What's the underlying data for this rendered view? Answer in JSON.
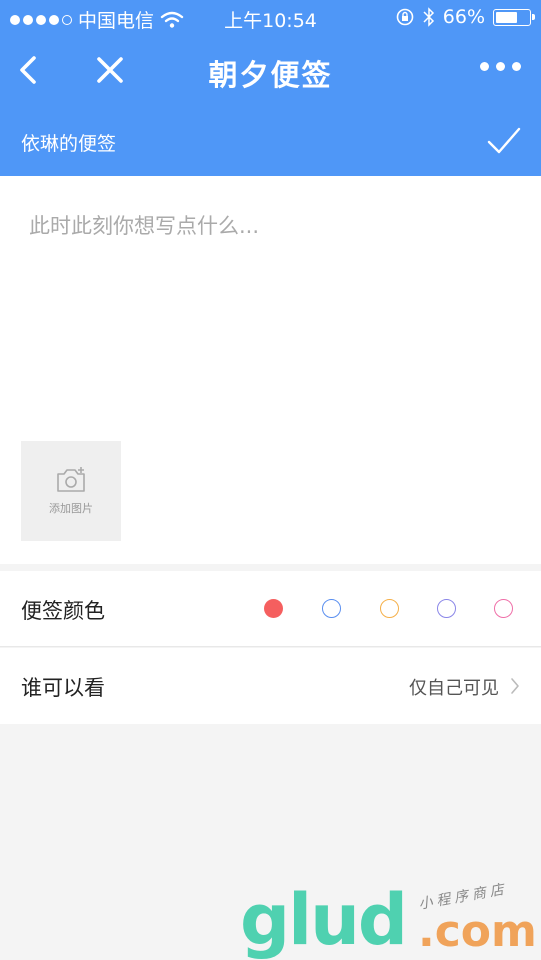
{
  "status_bar": {
    "carrier": "中国电信",
    "time": "上午10:54",
    "battery_percent": "66%",
    "battery_level": 0.66
  },
  "nav": {
    "title": "朝夕便签",
    "back_icon": "chevron-left-icon",
    "close_icon": "close-icon",
    "more_icon": "more-dots-icon"
  },
  "subbar": {
    "title": "依琳的便签",
    "confirm_icon": "checkmark-icon"
  },
  "editor": {
    "placeholder": "此时此刻你想写点什么...",
    "add_photo_label": "添加图片",
    "add_photo_icon": "camera-add-icon"
  },
  "settings": {
    "color": {
      "label": "便签颜色",
      "options": [
        {
          "color": "#f55f5f",
          "selected": true
        },
        {
          "color": "#5a8ff0",
          "selected": false
        },
        {
          "color": "#f5b04a",
          "selected": false
        },
        {
          "color": "#8a86e8",
          "selected": false
        },
        {
          "color": "#ef6fa8",
          "selected": false
        }
      ]
    },
    "visibility": {
      "label": "谁可以看",
      "value": "仅自己可见"
    }
  },
  "watermark": {
    "brand": "glud",
    "tld": ".com",
    "tagline": "小程序商店"
  },
  "colors": {
    "header_bg": "#4f97f7",
    "page_bg": "#f4f4f4"
  }
}
